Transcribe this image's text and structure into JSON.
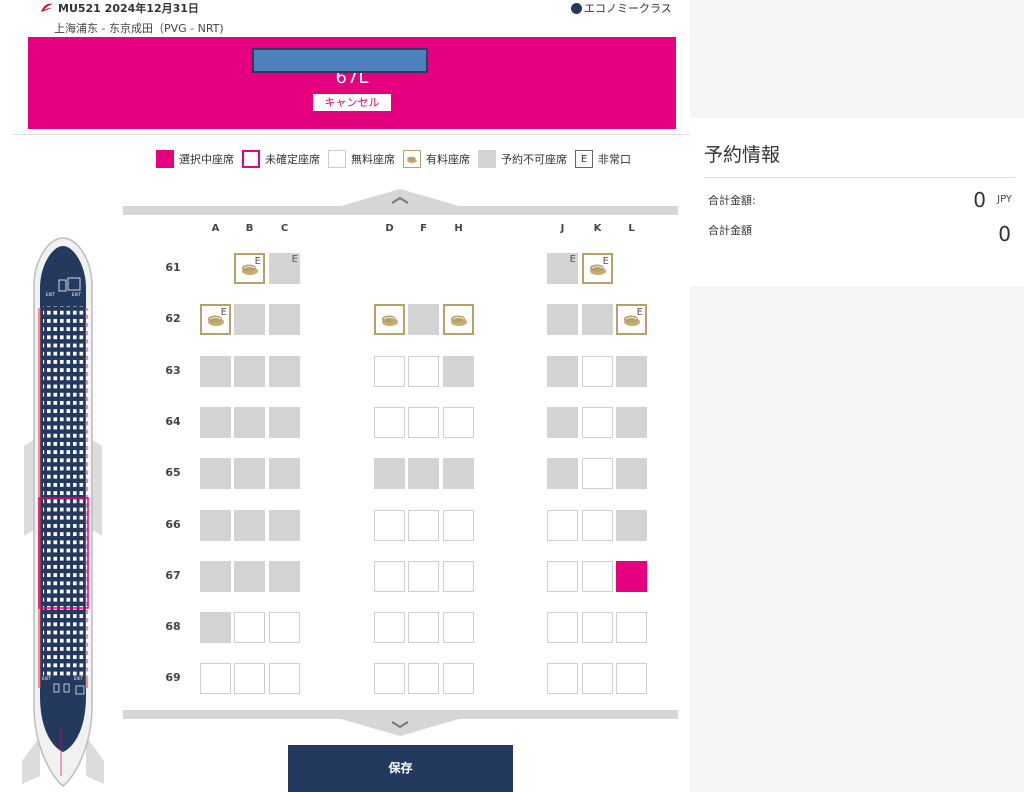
{
  "flight": {
    "header": "MU521 2024年12月31日",
    "route": "上海浦东 - 东京成田（PVG - NRT)",
    "cabin": "エコノミークラス"
  },
  "selection": {
    "seat": "67L",
    "cancel_label": "キャンセル"
  },
  "legend": [
    {
      "key": "selected",
      "label": "選択中座席"
    },
    {
      "key": "unconfirmed",
      "label": "未確定座席"
    },
    {
      "key": "free",
      "label": "無料座席"
    },
    {
      "key": "paid",
      "label": "有料座席"
    },
    {
      "key": "unavailable",
      "label": "予約不可座席"
    },
    {
      "key": "exit",
      "label": "非常口",
      "symbol": "E"
    }
  ],
  "seatmap": {
    "columns": [
      "A",
      "B",
      "C",
      "D",
      "F",
      "H",
      "J",
      "K",
      "L"
    ],
    "rows": [
      {
        "number": "61",
        "seats": {
          "B": "paid-exit",
          "C": "unavailable-exit",
          "J": "unavailable-exit",
          "K": "paid-exit"
        }
      },
      {
        "number": "62",
        "seats": {
          "A": "paid-exit",
          "B": "unavailable",
          "C": "unavailable",
          "D": "paid",
          "F": "unavailable",
          "H": "paid",
          "J": "unavailable",
          "K": "unavailable",
          "L": "paid-exit"
        }
      },
      {
        "number": "63",
        "seats": {
          "A": "unavailable",
          "B": "unavailable",
          "C": "unavailable",
          "D": "free",
          "F": "free",
          "H": "unavailable",
          "J": "unavailable",
          "K": "free",
          "L": "unavailable"
        }
      },
      {
        "number": "64",
        "seats": {
          "A": "unavailable",
          "B": "unavailable",
          "C": "unavailable",
          "D": "free",
          "F": "free",
          "H": "free",
          "J": "unavailable",
          "K": "free",
          "L": "unavailable"
        }
      },
      {
        "number": "65",
        "seats": {
          "A": "unavailable",
          "B": "unavailable",
          "C": "unavailable",
          "D": "unavailable",
          "F": "unavailable",
          "H": "unavailable",
          "J": "unavailable",
          "K": "free",
          "L": "unavailable"
        }
      },
      {
        "number": "66",
        "seats": {
          "A": "unavailable",
          "B": "unavailable",
          "C": "unavailable",
          "D": "free",
          "F": "free",
          "H": "free",
          "J": "free",
          "K": "free",
          "L": "unavailable"
        }
      },
      {
        "number": "67",
        "seats": {
          "A": "unavailable",
          "B": "unavailable",
          "C": "unavailable",
          "D": "free",
          "F": "free",
          "H": "free",
          "J": "free",
          "K": "free",
          "L": "selected"
        }
      },
      {
        "number": "68",
        "seats": {
          "A": "unavailable",
          "B": "free",
          "C": "free",
          "D": "free",
          "F": "free",
          "H": "free",
          "J": "free",
          "K": "free",
          "L": "free"
        }
      },
      {
        "number": "69",
        "seats": {
          "A": "free",
          "B": "free",
          "C": "free",
          "D": "free",
          "F": "free",
          "H": "free",
          "J": "free",
          "K": "free",
          "L": "free"
        }
      }
    ]
  },
  "buttons": {
    "save": "保存"
  },
  "booking": {
    "title": "予約情報",
    "total_label_1": "合計金額:",
    "total_value_1": "0",
    "currency": "JPY",
    "total_label_2": "合計金額",
    "total_value_2": "0"
  },
  "colors": {
    "accent": "#e4007f",
    "navy": "#23395d",
    "unavailable": "#d3d3d3",
    "paid_border": "#b8a06a"
  },
  "icons": [
    "airline-logo-icon",
    "cabin-dot-icon",
    "paid-seat-icon",
    "chevron-up-icon",
    "chevron-down-icon",
    "aircraft-overview-icon"
  ]
}
